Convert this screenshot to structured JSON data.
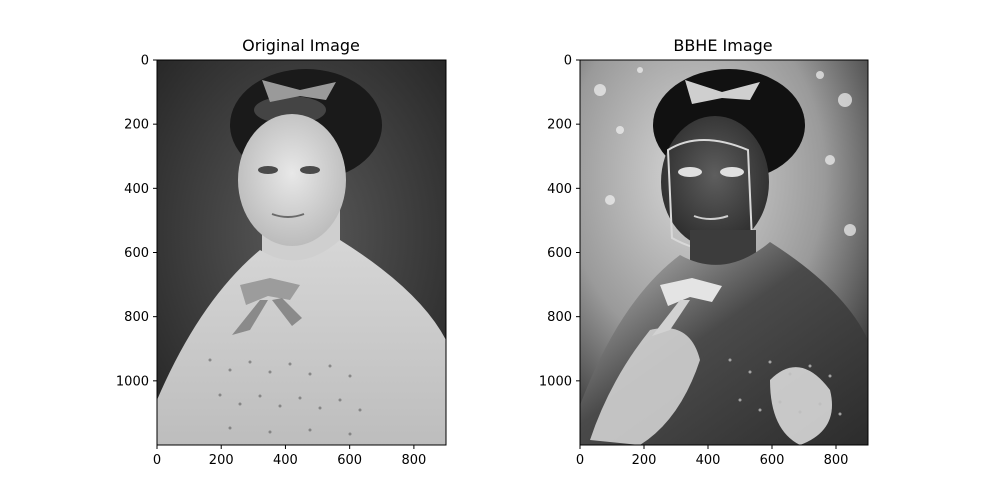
{
  "chart_data": [
    {
      "type": "image",
      "title": "Original Image",
      "xlim": [
        0,
        900
      ],
      "ylim": [
        1200,
        0
      ],
      "xticks": [
        0,
        200,
        400,
        600,
        800
      ],
      "yticks": [
        0,
        200,
        400,
        600,
        800,
        1000
      ],
      "colormap": "gray",
      "image_content": "grayscale vintage portrait photograph"
    },
    {
      "type": "image",
      "title": "BBHE Image",
      "xlim": [
        0,
        900
      ],
      "ylim": [
        1200,
        0
      ],
      "xticks": [
        0,
        200,
        400,
        600,
        800
      ],
      "yticks": [
        0,
        200,
        400,
        600,
        800,
        1000
      ],
      "colormap": "gray",
      "image_content": "grayscale portrait after bi-histogram equalization"
    }
  ]
}
